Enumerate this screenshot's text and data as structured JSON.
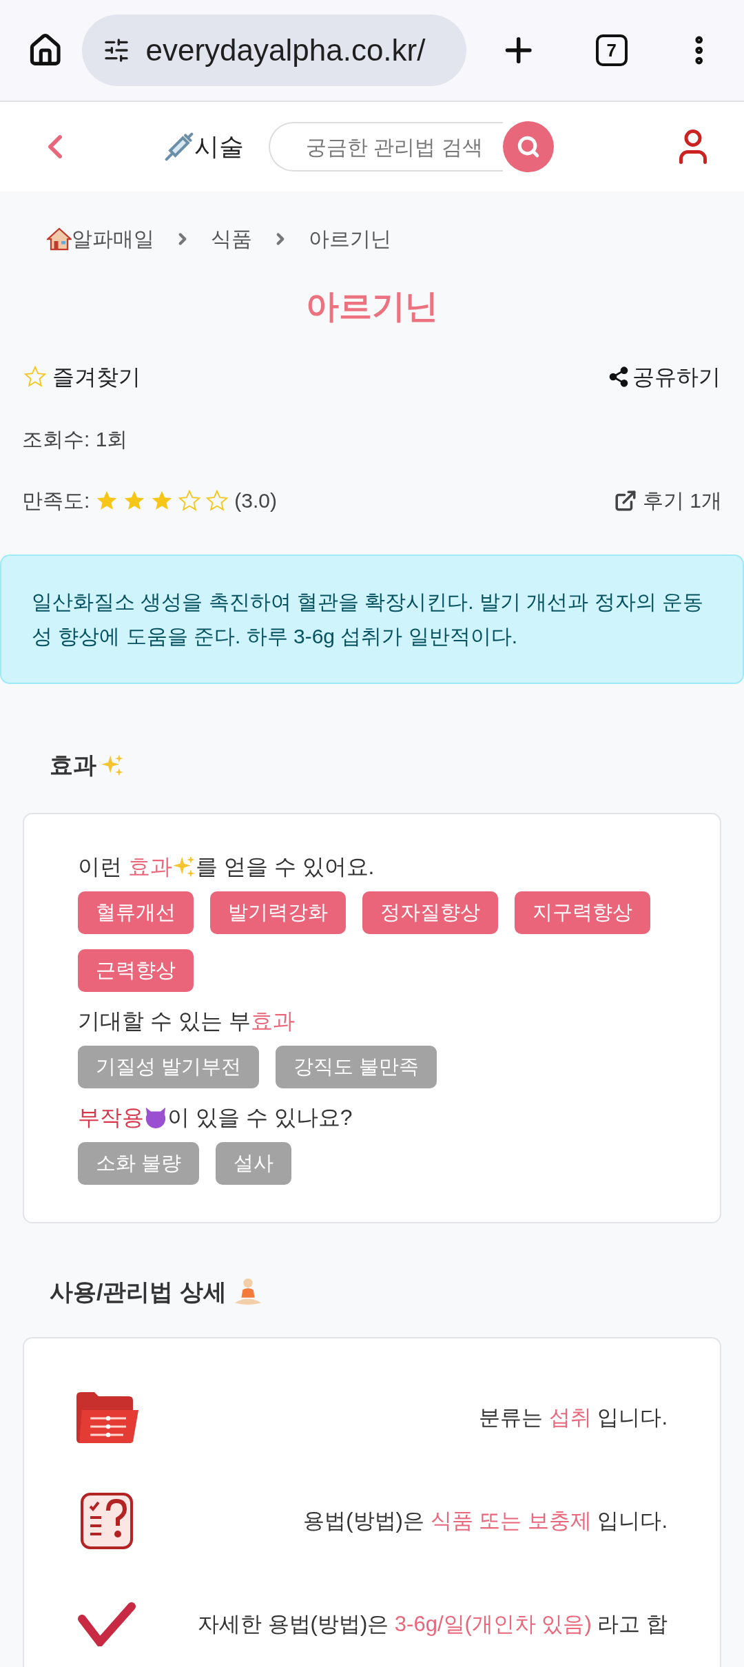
{
  "browser": {
    "url": "everydayalpha.co.kr/",
    "tab_count": "7"
  },
  "header": {
    "category": "시술",
    "search_placeholder": "궁금한 관리법 검색"
  },
  "breadcrumb": [
    "알파매일",
    "식품",
    "아르기닌"
  ],
  "title": "아르기닌",
  "favorite": {
    "label": "즐겨찾기",
    "on": false
  },
  "share": {
    "label": "공유하기"
  },
  "views": "조회수: 1회",
  "rating": {
    "label": "만족도:",
    "stars": 3,
    "score": "(3.0)"
  },
  "reviews": "후기 1개",
  "summary": "일산화질소 생성을 촉진하여 혈관을 확장시킨다. 발기 개선과 정자의 운동성 향상에 도움을 준다. 하루 3-6g 섭취가 일반적이다.",
  "effects": {
    "heading": "효과",
    "groups": [
      {
        "kind": "effects",
        "before": "이런 ",
        "highlight": "효과",
        "after": "를 얻을 수 있어요.",
        "tags": [
          "혈류개선",
          "발기력강화",
          "정자질향상",
          "지구력향상",
          "근력향상"
        ]
      },
      {
        "kind": "side_effects",
        "before": "기대할 수 있는 부",
        "highlight": "효과",
        "tags": [
          "기질성 발기부전",
          "강직도 불만족"
        ]
      },
      {
        "kind": "adverse",
        "highlight": "부작용",
        "after": "이 있을 수 있나요?",
        "tags": [
          "소화 불량",
          "설사"
        ]
      }
    ]
  },
  "usage": {
    "heading": "사용/관리법 상세",
    "rows": [
      {
        "kind": "folder",
        "before": "분류는 ",
        "highlight": "섭취",
        "after": " 입니다."
      },
      {
        "kind": "question",
        "before": "용법(방법)은 ",
        "highlight": "식품 또는 보충제",
        "after": " 입니다."
      },
      {
        "kind": "check",
        "before": "자세한 용법(방법)은 ",
        "highlight": "3-6g/일(개인차 있음)",
        "after": " 라고 합"
      }
    ]
  }
}
